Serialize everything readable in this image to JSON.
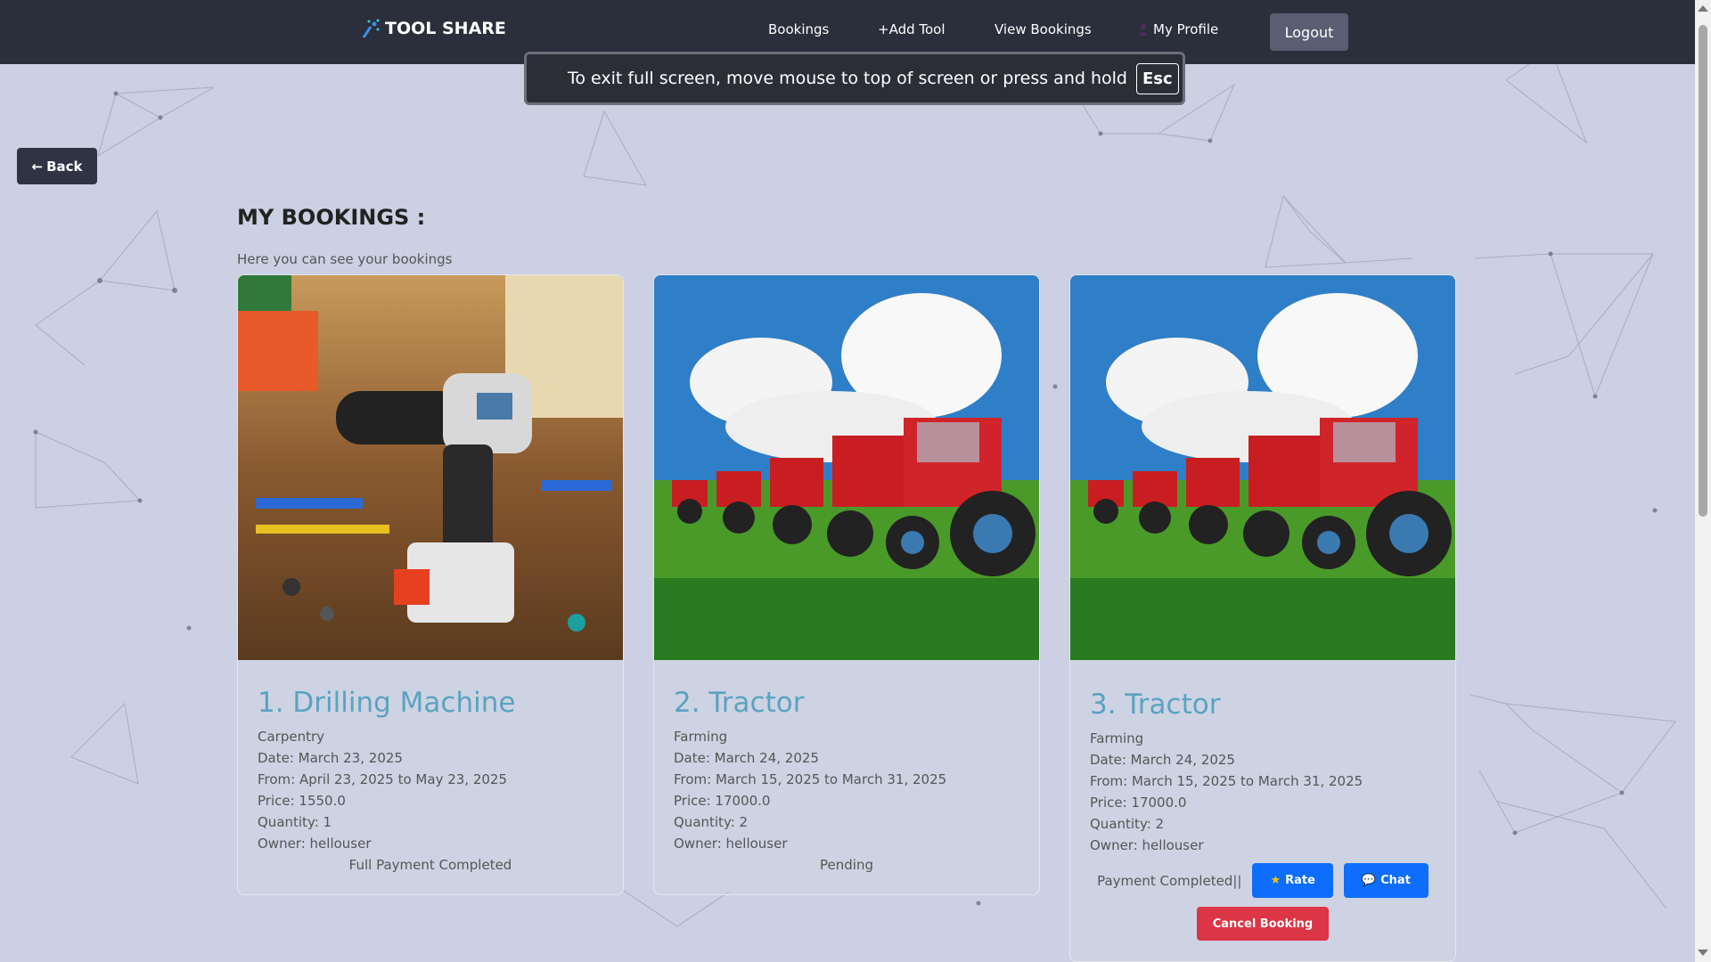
{
  "brand": {
    "name": "TOOL SHARE"
  },
  "nav": {
    "bookings": "Bookings",
    "add_tool": "+Add Tool",
    "view_bookings": "View Bookings",
    "my_profile": "My Profile",
    "logout": "Logout"
  },
  "fullscreen_banner": {
    "text": "To exit full screen, move mouse to top of screen or press and hold",
    "key": "Esc"
  },
  "back_button": {
    "label": "Back",
    "icon": "arrow-left-icon"
  },
  "page": {
    "title": "MY BOOKINGS :",
    "subtitle": "Here you can see your bookings"
  },
  "bookings": [
    {
      "title": "1. Drilling Machine",
      "category": "Carpentry",
      "date": "Date: March 23, 2025",
      "from": "From: April 23, 2025 to May 23, 2025",
      "price": "Price: 1550.0",
      "quantity": "Quantity: 1",
      "owner": "Owner: hellouser",
      "status": "Full Payment Completed",
      "image": "cordless-drill-workbench-image"
    },
    {
      "title": "2. Tractor",
      "category": "Farming",
      "date": "Date: March 24, 2025",
      "from": "From: March 15, 2025 to March 31, 2025",
      "price": "Price: 17000.0",
      "quantity": "Quantity: 2",
      "owner": "Owner: hellouser",
      "status": "Pending",
      "image": "red-tractors-field-image"
    },
    {
      "title": "3. Tractor",
      "category": "Farming",
      "date": "Date: March 24, 2025",
      "from": "From: March 15, 2025 to March 31, 2025",
      "price": "Price: 17000.0",
      "quantity": "Quantity: 2",
      "owner": "Owner: hellouser",
      "status": "Payment Completed||",
      "image": "red-tractors-field-image",
      "actions": {
        "rate": "Rate",
        "chat": "Chat",
        "cancel": "Cancel Booking"
      }
    }
  ],
  "colors": {
    "navbar": "#2b2e3b",
    "background": "#cbd0e3",
    "card_title": "#5aa3c0",
    "primary_button": "#0d6efd",
    "danger_button": "#dc3545"
  }
}
